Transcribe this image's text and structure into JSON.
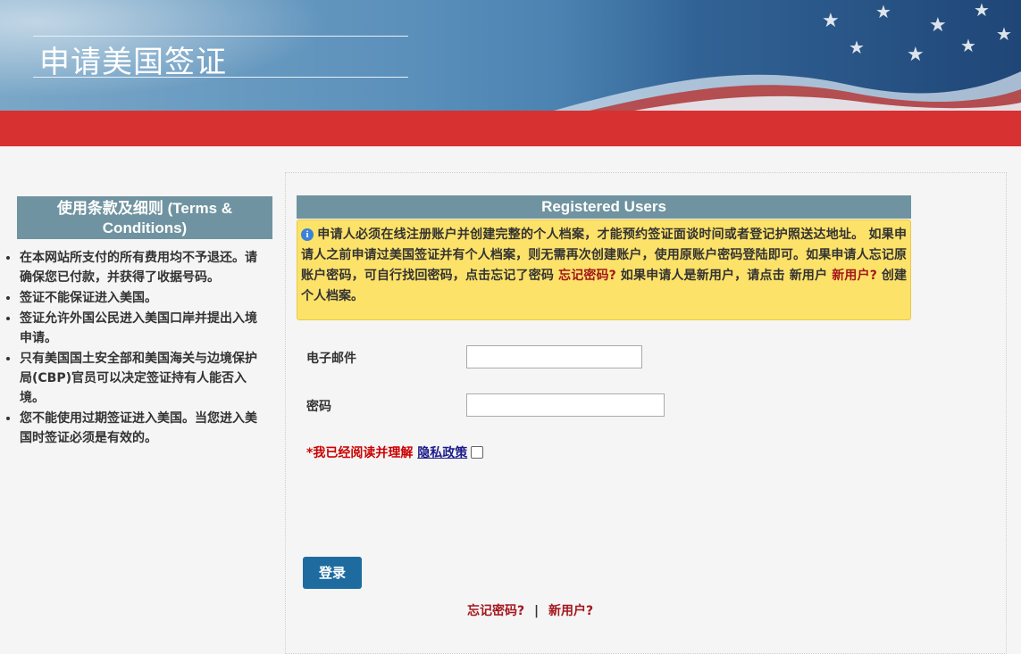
{
  "header": {
    "title": "申请美国签证"
  },
  "terms": {
    "title": "使用条款及细则 (Terms & Conditions)",
    "items": [
      "在本网站所支付的所有费用均不予退还。请确保您已付款，并获得了收据号码。",
      "签证不能保证进入美国。",
      "签证允许外国公民进入美国口岸并提出入境申请。",
      "只有美国国土安全部和美国海关与边境保护局(CBP)官员可以决定签证持有人能否入境。",
      "您不能使用过期签证进入美国。当您进入美国时签证必须是有效的。"
    ]
  },
  "registered": {
    "title": "Registered Users",
    "notice_part1": "申请人必须在线注册账户并创建完整的个人档案，才能预约签证面谈时间或者登记护照送达地址。 如果申请人之前申请过美国签证并有个人档案，则无需再次创建账户，使用原账户密码登陆即可。如果申请人忘记原账户密码，可自行找回密码，点击忘记了密码 ",
    "notice_link1": "忘记密码?",
    "notice_part2": " 如果申请人是新用户，请点击 新用户 ",
    "notice_link2": "新用户?",
    "notice_part3": " 创建个人档案。"
  },
  "form": {
    "email_label": "电子邮件",
    "email_value": "",
    "password_label": "密码",
    "password_value": "",
    "agree_required": "*我已经阅读并理解",
    "privacy_link": "隐私政策",
    "login_button": "登录",
    "forgot_link": "忘记密码?",
    "separator": "|",
    "new_user_link": "新用户?"
  },
  "colors": {
    "red_bar": "#d83131",
    "header_bg": "#6f93a0",
    "notice_bg": "#fde269",
    "button_bg": "#1e6c9f",
    "link_red": "#a3161d"
  }
}
